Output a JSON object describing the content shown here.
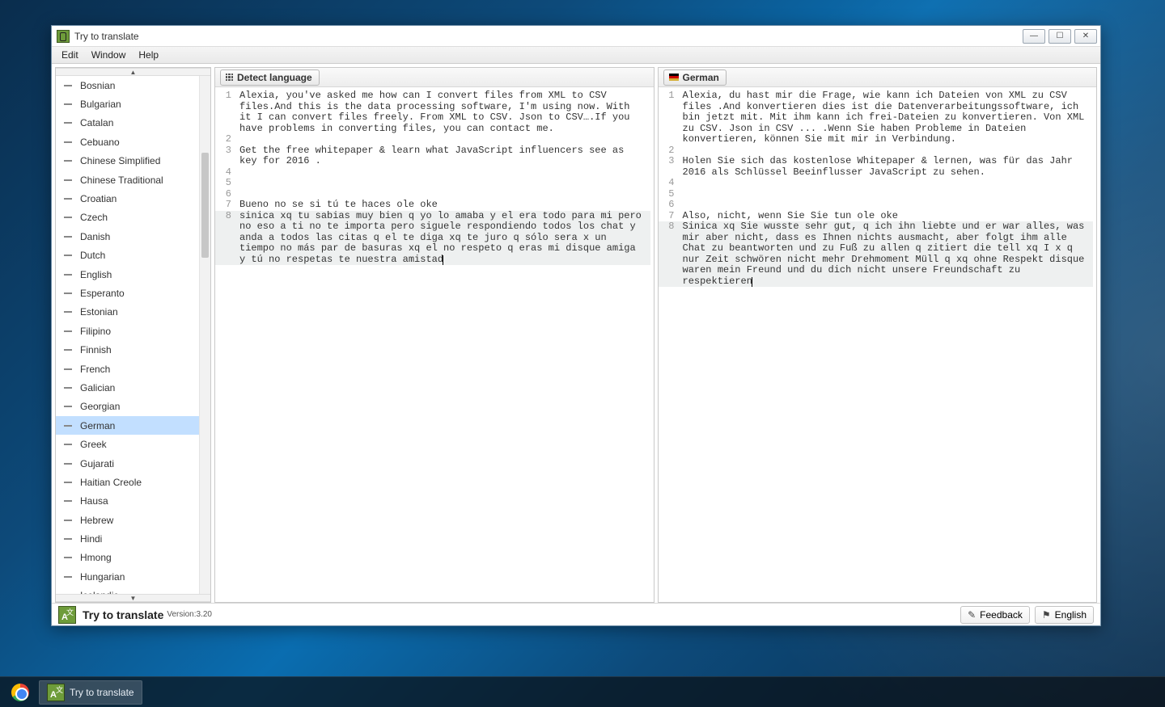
{
  "window": {
    "title": "Try to translate",
    "menus": [
      "Edit",
      "Window",
      "Help"
    ]
  },
  "languages": {
    "selected": "German",
    "list": [
      "Bosnian",
      "Bulgarian",
      "Catalan",
      "Cebuano",
      "Chinese Simplified",
      "Chinese Traditional",
      "Croatian",
      "Czech",
      "Danish",
      "Dutch",
      "English",
      "Esperanto",
      "Estonian",
      "Filipino",
      "Finnish",
      "French",
      "Galician",
      "Georgian",
      "German",
      "Greek",
      "Gujarati",
      "Haitian Creole",
      "Hausa",
      "Hebrew",
      "Hindi",
      "Hmong",
      "Hungarian",
      "Icelandic"
    ]
  },
  "left_editor": {
    "lang_button": "Detect language",
    "lines": [
      {
        "n": 1,
        "t": "Alexia, you've asked me how can I convert files from XML to CSV files.And this is the data processing software, I'm using now. With it I can convert files freely. From XML to CSV. Json to CSV….If you have problems in converting files, you can contact me."
      },
      {
        "n": 2,
        "t": ""
      },
      {
        "n": 3,
        "t": "Get the free whitepaper & learn what JavaScript influencers see as key for 2016 ."
      },
      {
        "n": 4,
        "t": ""
      },
      {
        "n": 5,
        "t": ""
      },
      {
        "n": 6,
        "t": ""
      },
      {
        "n": 7,
        "t": "Bueno no se si tú te haces ole oke"
      },
      {
        "n": 8,
        "t": "sinica xq tu sabias muy bien q yo lo amaba y el era todo para mi pero no eso a ti no te importa pero siguele respondiendo todos los chat y anda a todos las citas q el te diga xq te juro q sólo sera x un tiempo no más par de basuras xq el no respeto q eras mi disque amiga y tú no respetas te nuestra amistad",
        "hl": true,
        "cursor": true
      }
    ]
  },
  "right_editor": {
    "lang_button": "German",
    "lines": [
      {
        "n": 1,
        "t": "Alexia, du hast mir die Frage, wie kann ich Dateien von XML zu CSV files .And konvertieren dies ist die Datenverarbeitungssoftware, ich bin jetzt mit. Mit ihm kann ich frei-Dateien zu konvertieren. Von XML zu CSV. Json in CSV ... .Wenn Sie haben Probleme in Dateien konvertieren, können Sie mit mir in Verbindung."
      },
      {
        "n": 2,
        "t": ""
      },
      {
        "n": 3,
        "t": "Holen Sie sich das kostenlose Whitepaper & lernen, was für das Jahr 2016 als Schlüssel Beeinflusser JavaScript zu sehen."
      },
      {
        "n": 4,
        "t": ""
      },
      {
        "n": 5,
        "t": ""
      },
      {
        "n": 6,
        "t": ""
      },
      {
        "n": 7,
        "t": "Also, nicht, wenn Sie Sie tun ole oke"
      },
      {
        "n": 8,
        "t": "Sinica xq Sie wusste sehr gut, q ich ihn liebte und er war alles, was mir aber nicht, dass es Ihnen nichts ausmacht, aber folgt ihm alle Chat zu beantworten und zu Fuß zu allen q zitiert die tell xq I x q nur Zeit schwören nicht mehr Drehmoment Müll q xq ohne Respekt disque waren mein Freund und du dich nicht unsere Freundschaft zu respektieren",
        "hl": true,
        "cursor": true
      }
    ]
  },
  "status": {
    "title": "Try to translate",
    "version": "Version:3.20",
    "feedback": "Feedback",
    "english": "English"
  },
  "taskbar": {
    "app_label": "Try to translate"
  }
}
